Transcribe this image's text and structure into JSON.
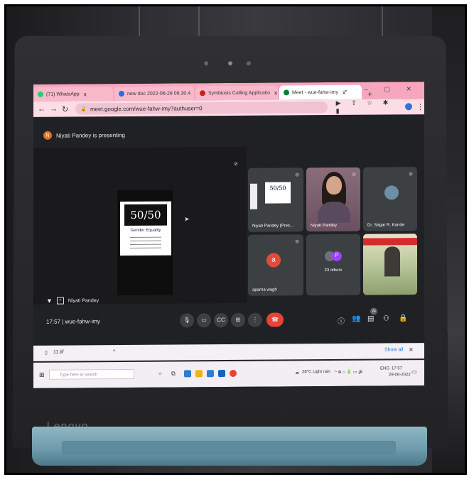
{
  "browser": {
    "tabs": [
      {
        "label": "(71) WhatsApp",
        "icon_color": "#25d366"
      },
      {
        "label": "new doc 2022-06-29 09.30.4",
        "icon_color": "#1a73e8"
      },
      {
        "label": "Symbiosis Calling Applicatio",
        "icon_color": "#c5221f"
      },
      {
        "label": "Meet - wue-fahw-imy",
        "icon_color": "#00832d"
      }
    ],
    "new_tab": "+",
    "close": "x",
    "url": "meet.google.com/wue-fahw-imy?authuser=0"
  },
  "meet": {
    "presenting_initial": "N",
    "presenting_text": "Niyati Pandey is presenting",
    "pinned_name": "Niyati Pandey",
    "slide": {
      "logo": "50/50",
      "title": "Gender Equality"
    },
    "tiles": [
      {
        "name": "Niyati Pandey (Pres..."
      },
      {
        "name": "Niyati Pandey"
      },
      {
        "name": "Dr. Sagar R. Kande"
      },
      {
        "name": "aparna wagh",
        "initial": "a"
      },
      {
        "name": "23 others",
        "initial": "P"
      },
      {
        "name": ""
      }
    ],
    "time_code": "17:57  |  wue-fahw-imy",
    "participant_count": "24"
  },
  "downloads": {
    "file": "11.tif",
    "show_all": "Show all"
  },
  "taskbar": {
    "search_placeholder": "Type here to search",
    "weather": "28°C  Light rain",
    "lang": "ENG",
    "time": "17:57",
    "date": "29-06-2022"
  },
  "laptop": {
    "brand": "Lenovo"
  }
}
